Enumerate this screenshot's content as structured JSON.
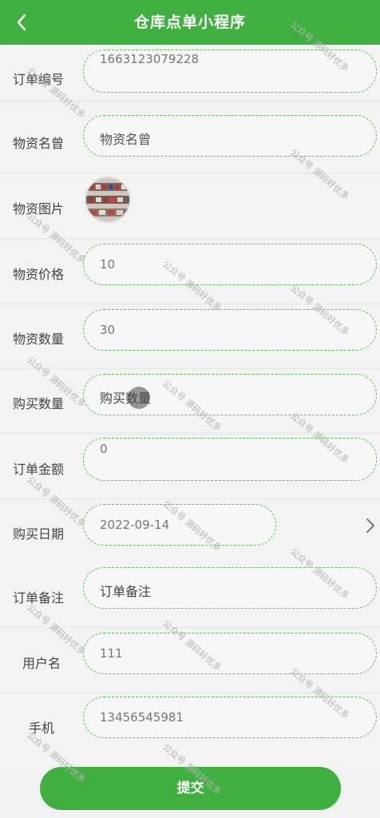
{
  "header": {
    "title": "仓库点单小程序",
    "back_icon": "chevron-left-icon"
  },
  "form": {
    "order_no": {
      "label": "订单编号",
      "value": "1663123079228"
    },
    "item_name": {
      "label": "物资名曾",
      "value": "物资名曾"
    },
    "item_image": {
      "label": "物资图片"
    },
    "item_price": {
      "label": "物资价格",
      "value": "10"
    },
    "item_qty": {
      "label": "物资数量",
      "value": "30"
    },
    "buy_qty": {
      "label": "购买数量",
      "value": "购买数量"
    },
    "order_amount": {
      "label": "订单金额",
      "value": "0"
    },
    "buy_date": {
      "label": "购买日期",
      "value": "2022-09-14"
    },
    "order_note": {
      "label": "订单备注",
      "value": "订单备注"
    },
    "username": {
      "label": "用户名",
      "value": "111"
    },
    "phone": {
      "label": "手机",
      "value": "13456545981"
    }
  },
  "submit_label": "提交",
  "watermark": "公众号 源码好优多",
  "colors": {
    "primary": "#3faf3f",
    "field_border": "#5cc15c"
  }
}
